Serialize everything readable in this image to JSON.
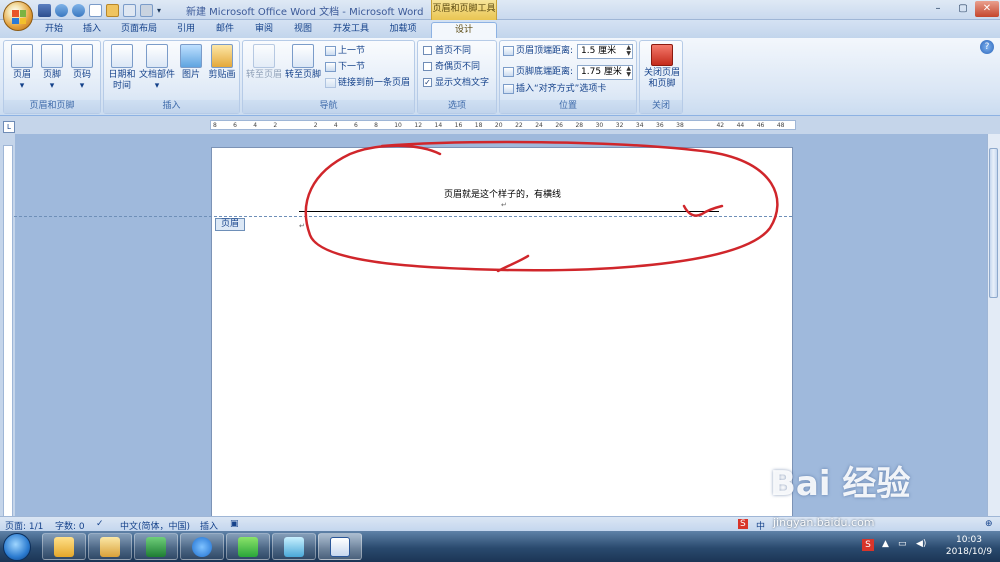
{
  "titlebar": {
    "doc_title": "新建 Microsoft Office Word 文档 - Microsoft Word",
    "context_tool": "页眉和页脚工具",
    "minimize": "–",
    "maximize": "▢",
    "close": "✕"
  },
  "tabs": [
    "开始",
    "插入",
    "页面布局",
    "引用",
    "邮件",
    "审阅",
    "视图",
    "开发工具",
    "加载项",
    "设计"
  ],
  "ribbon": {
    "group_header_footer": {
      "label": "页眉和页脚",
      "header": "页眉",
      "footer": "页脚",
      "page_number": "页码"
    },
    "group_insert": {
      "label": "插入",
      "date_time_1": "日期和",
      "date_time_2": "时间",
      "doc_parts": "文档部件",
      "picture": "图片",
      "clipart": "剪贴画"
    },
    "group_nav": {
      "label": "导航",
      "goto_header": "转至页眉",
      "goto_footer": "转至页脚",
      "prev_section": "上一节",
      "next_section": "下一节",
      "link_prev": "链接到前一条页眉"
    },
    "group_options": {
      "label": "选项",
      "diff_first": "首页不同",
      "diff_odd_even": "奇偶页不同",
      "show_text": "显示文档文字"
    },
    "group_position": {
      "label": "位置",
      "header_top_label": "页眉顶端距离:",
      "header_top_value": "1.5 厘米",
      "footer_bottom_label": "页脚底端距离:",
      "footer_bottom_value": "1.75 厘米",
      "insert_align_tab": "插入“对齐方式”选项卡"
    },
    "group_close": {
      "label": "关闭",
      "close_1": "关闭页眉",
      "close_2": "和页脚"
    }
  },
  "ruler": {
    "marks": [
      "8",
      "6",
      "4",
      "2",
      "",
      "2",
      "4",
      "6",
      "8",
      "10",
      "12",
      "14",
      "16",
      "18",
      "20",
      "22",
      "24",
      "26",
      "28",
      "30",
      "32",
      "34",
      "36",
      "38",
      "",
      "42",
      "44",
      "46",
      "48"
    ]
  },
  "document": {
    "header_text": "页眉就是这个样子的，有横线",
    "header_tag": "页眉"
  },
  "statusbar": {
    "page": "页面: 1/1",
    "words": "字数: 0",
    "language": "中文(简体，中国)",
    "mode": "插入",
    "ime": "中"
  },
  "taskbar": {
    "time": "10:03",
    "date": "2018/10/9"
  },
  "watermark": {
    "text": "Bai 经验",
    "url": "jingyan.baidu.com"
  },
  "colors": {
    "ribbon_bg": "#dae6f5",
    "accent": "#15428b",
    "annotation": "#d0262b",
    "context_tab": "#e9c552"
  }
}
